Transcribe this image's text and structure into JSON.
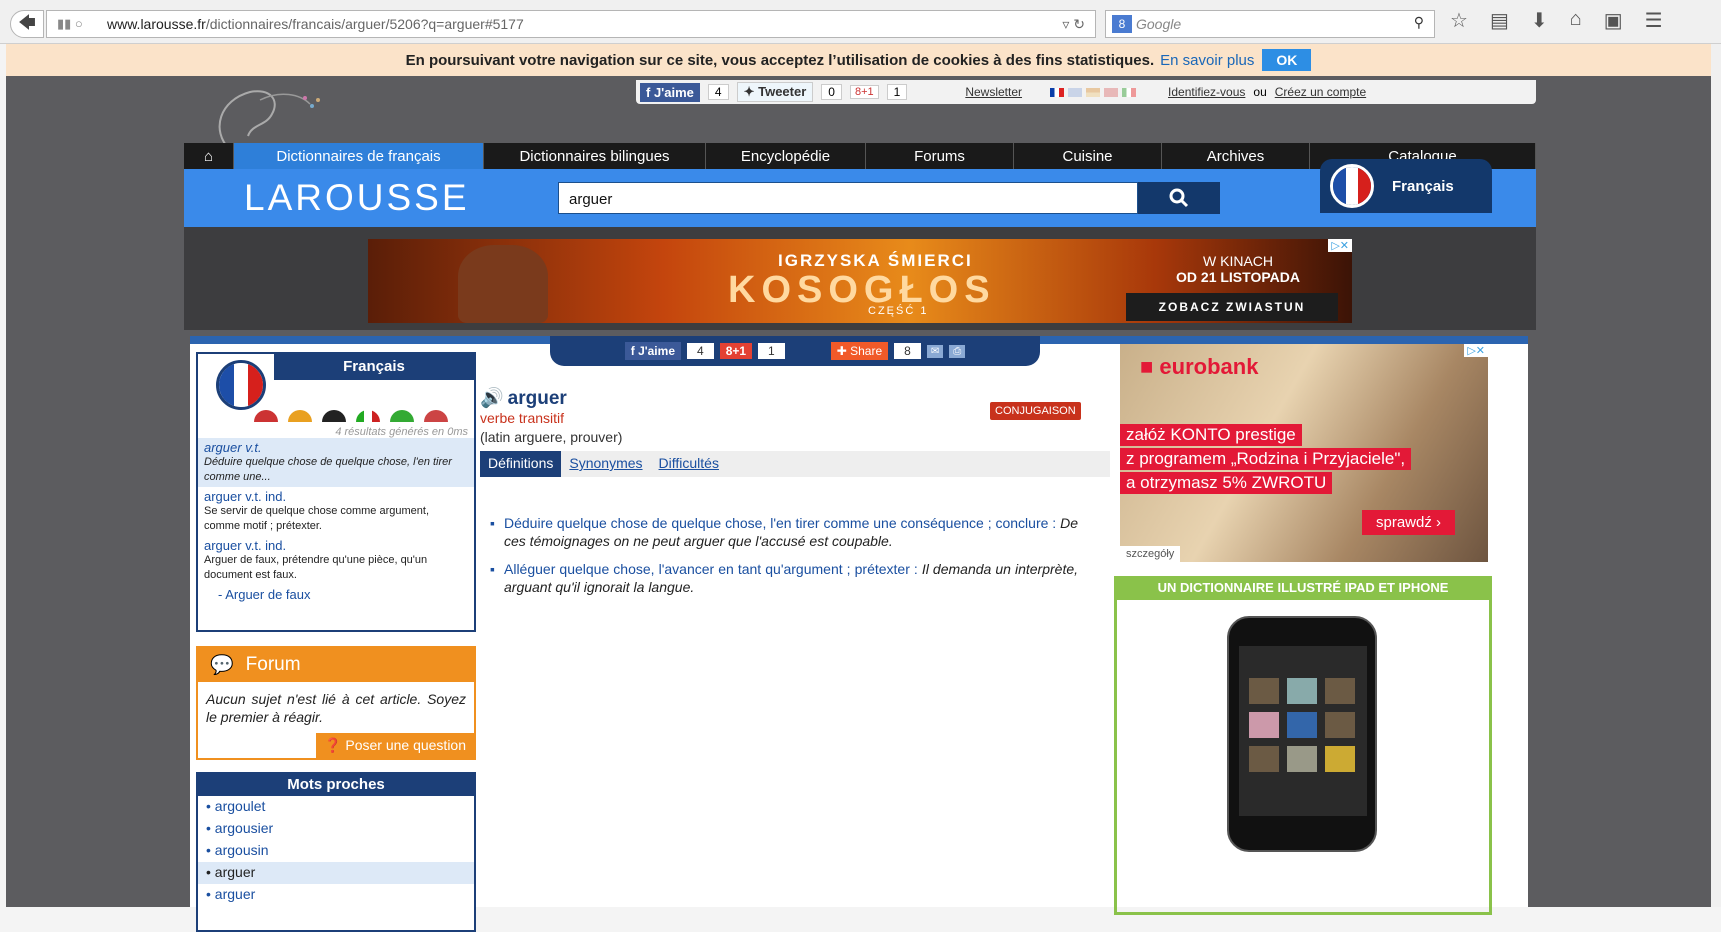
{
  "browser": {
    "url_host": "www.larousse.fr",
    "url_path": "/dictionnaires/francais/arguer/5206?q=arguer#5177",
    "search_placeholder": "Google"
  },
  "cookie": {
    "text": "En poursuivant votre navigation sur ce site, vous acceptez l’utilisation de cookies à des fins statistiques.",
    "link": "En savoir plus",
    "ok": "OK"
  },
  "topbar": {
    "like": "J'aime",
    "like_count": "4",
    "tweet": "Tweeter",
    "tweet_count": "0",
    "gplus": "8+1",
    "gplus_count": "1",
    "newsletter": "Newsletter",
    "identify": "Identifiez-vous",
    "or": "ou",
    "create": "Créez un compte"
  },
  "nav": {
    "items": [
      "Dictionnaires de français",
      "Dictionnaires bilingues",
      "Encyclopédie",
      "Forums",
      "Cuisine",
      "Archives",
      "Catalogue"
    ]
  },
  "header": {
    "brand": "LAROUSSE",
    "search_value": "arguer",
    "lang": "Français"
  },
  "ad": {
    "line1": "IGRZYSKA ŚMIERCI",
    "line2": "KOSOGŁOS",
    "line3": "CZĘŚĆ 1",
    "date1": "W KINACH",
    "date2": "OD 21 LISTOPADA",
    "cta": "ZOBACZ ZWIASTUN"
  },
  "left": {
    "title": "Français",
    "meta": "4 résultats générés en 0ms",
    "results": [
      {
        "head": "arguer v.t.",
        "desc": "Déduire quelque chose de quelque chose, l'en tirer comme une..."
      },
      {
        "head": "arguer v.t. ind.",
        "desc": "Se servir de quelque chose comme argument, comme motif ; prétexter."
      },
      {
        "head": "arguer v.t. ind.",
        "desc": "Arguer de faux, prétendre qu'une pièce, qu'un document est faux."
      }
    ],
    "sub": "- Arguer de faux",
    "forum_title": "Forum",
    "forum_text": "Aucun sujet n'est lié à cet article. Soyez le premier à réagir.",
    "forum_btn": "Poser une question",
    "proches_title": "Mots proches",
    "proches": [
      "argoulet",
      "argousier",
      "argousin",
      "arguer",
      "arguer"
    ]
  },
  "main": {
    "share": {
      "like": "J'aime",
      "like_count": "4",
      "gplus": "8+1",
      "gplus_count": "1",
      "share": "Share",
      "share_count": "8"
    },
    "word": "arguer",
    "pos": "verbe transitif",
    "etymology": "(latin arguere, prouver)",
    "conj": "CONJUGAISON",
    "tabs": [
      "Définitions",
      "Synonymes",
      "Difficultés"
    ],
    "def1": "Déduire quelque chose de quelque chose, l'en tirer comme une conséquence ; conclure :",
    "def1_ex": "De ces témoignages on ne peut arguer que l'accusé est coupable.",
    "def2": "Alléguer quelque chose, l'avancer en tant qu'argument ; prétexter :",
    "def2_ex": "Il demanda un interprète, arguant qu'il ignorait la langue."
  },
  "right": {
    "bank": "eurobank",
    "l1": "załóż KONTO prestige",
    "l2": "z programem „Rodzina i Przyjaciele\",",
    "l3": "a otrzymasz 5% ZWROTU",
    "cta": "sprawdź",
    "small": "szczegóły",
    "ipad_title": "UN DICTIONNAIRE ILLUSTRÉ IPAD ET IPHONE"
  }
}
